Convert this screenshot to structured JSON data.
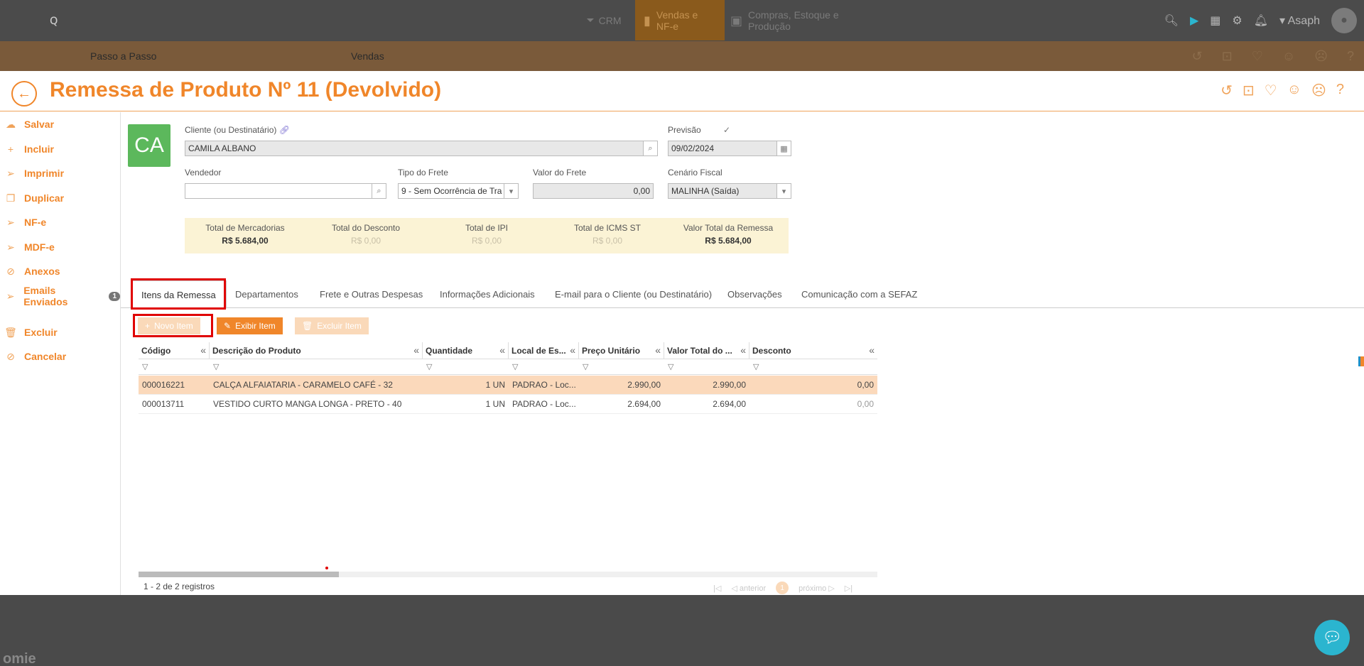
{
  "topbar": {
    "logo": "ꞯ",
    "nav": [
      {
        "label": "CRM"
      },
      {
        "label": "Vendas e NF-e"
      },
      {
        "label": "Compras, Estoque e Produção"
      }
    ],
    "user": "Asaph"
  },
  "subbar": {
    "passo": "Passo a Passo",
    "vendas": "Vendas"
  },
  "page": {
    "title": "Remessa de Produto Nº 11 (Devolvido)"
  },
  "sidebar": {
    "items": [
      {
        "label": "Salvar",
        "icon": "cloud-icon"
      },
      {
        "label": "Incluir",
        "icon": "plus-icon"
      },
      {
        "label": "Imprimir",
        "icon": "send-icon"
      },
      {
        "label": "Duplicar",
        "icon": "copy-icon"
      },
      {
        "label": "NF-e",
        "icon": "send-icon"
      },
      {
        "label": "MDF-e",
        "icon": "send-icon"
      },
      {
        "label": "Anexos",
        "icon": "paperclip-icon"
      },
      {
        "label": "Emails Enviados",
        "icon": "send-icon",
        "badge": "1"
      },
      {
        "label": "Excluir",
        "icon": "trash-icon"
      },
      {
        "label": "Cancelar",
        "icon": "ban-icon"
      }
    ]
  },
  "form": {
    "avatar": "CA",
    "cliente_label": "Cliente (ou Destinatário)",
    "cliente_value": "CAMILA ALBANO",
    "previsao_label": "Previsão",
    "previsao_value": "09/02/2024",
    "vendedor_label": "Vendedor",
    "vendedor_value": "",
    "frete_label": "Tipo do Frete",
    "frete_value": "9 - Sem Ocorrência de Tra",
    "valor_frete_label": "Valor do Frete",
    "valor_frete_value": "0,00",
    "cenario_label": "Cenário Fiscal",
    "cenario_value": "MALINHA (Saída)"
  },
  "totals": [
    {
      "label": "Total de Mercadorias",
      "value": "R$ 5.684,00"
    },
    {
      "label": "Total do Desconto",
      "value": "R$ 0,00"
    },
    {
      "label": "Total de IPI",
      "value": "R$ 0,00"
    },
    {
      "label": "Total de ICMS ST",
      "value": "R$ 0,00"
    },
    {
      "label": "Valor Total da Remessa",
      "value": "R$ 5.684,00"
    }
  ],
  "tabs": [
    {
      "label": "Itens da Remessa"
    },
    {
      "label": "Departamentos"
    },
    {
      "label": "Frete e Outras Despesas"
    },
    {
      "label": "Informações Adicionais"
    },
    {
      "label": "E-mail para o Cliente (ou Destinatário)"
    },
    {
      "label": "Observações"
    },
    {
      "label": "Comunicação com a SEFAZ"
    }
  ],
  "toolbar": {
    "novo": "Novo Item",
    "exibir": "Exibir Item",
    "excluir": "Excluir Item"
  },
  "grid": {
    "columns": [
      "Código",
      "Descrição do Produto",
      "Quantidade",
      "Local de Es...",
      "Preço Unitário",
      "Valor Total do ...",
      "Desconto"
    ],
    "rows": [
      {
        "codigo": "000016221",
        "descricao": "CALÇA ALFAIATARIA - CARAMELO CAFÉ - 32",
        "quantidade": "1 UN",
        "local": "PADRAO - Loc...",
        "preco": "2.990,00",
        "total": "2.990,00",
        "desconto": "0,00"
      },
      {
        "codigo": "000013711",
        "descricao": "VESTIDO CURTO MANGA LONGA - PRETO - 40",
        "quantidade": "1 UN",
        "local": "PADRAO - Loc...",
        "preco": "2.694,00",
        "total": "2.694,00",
        "desconto": "0,00"
      }
    ],
    "footer": "1 - 2 de 2 registros",
    "pager": {
      "prev": "anterior",
      "page": "1",
      "next": "próximo"
    }
  },
  "bottom": {
    "logo": "omie"
  }
}
